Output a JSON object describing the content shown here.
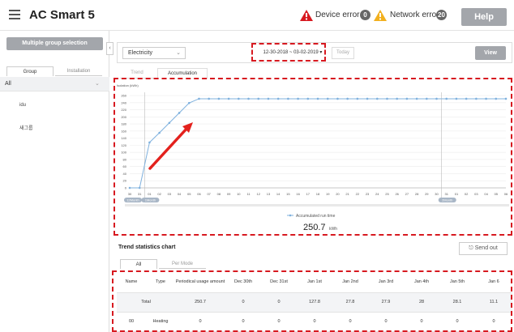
{
  "app": {
    "title": "AC Smart 5"
  },
  "header": {
    "device_error_label": "Device error",
    "device_error_count": "0",
    "network_error_label": "Network error",
    "network_error_count": "20",
    "help_label": "Help"
  },
  "sidebar": {
    "multi_select_label": "Multiple group selection",
    "tabs": [
      {
        "label": "Group"
      },
      {
        "label": "Installation"
      }
    ],
    "all_label": "All",
    "items": [
      {
        "label": "idu"
      },
      {
        "label": "새그룹"
      }
    ]
  },
  "filters": {
    "energy_type": "Electricity",
    "date_range": "12-30-2018 ~ 03-02-2019 ▾",
    "today_label": "Today",
    "view_label": "View"
  },
  "chart_tabs": [
    {
      "label": "Trend"
    },
    {
      "label": "Accumulation"
    }
  ],
  "colors": {
    "series": "#7fb1de",
    "highlight": "#d71920",
    "arrow": "#e3211d"
  },
  "chart_data": {
    "type": "line",
    "ylabel": "Isolation (kWh)",
    "ylim": [
      0,
      260
    ],
    "yticks": [
      0,
      20,
      40,
      60,
      80,
      100,
      120,
      140,
      160,
      180,
      200,
      220,
      240,
      260
    ],
    "x": [
      "30",
      "31",
      "01",
      "02",
      "03",
      "04",
      "05",
      "06",
      "07",
      "08",
      "09",
      "10",
      "11",
      "12",
      "13",
      "14",
      "15",
      "16",
      "17",
      "18",
      "19",
      "20",
      "21",
      "22",
      "23",
      "24",
      "25",
      "26",
      "27",
      "28",
      "29",
      "30",
      "31",
      "01",
      "02",
      "03",
      "04",
      "05",
      "06"
    ],
    "month_labels": [
      {
        "label": "12Month",
        "at": "30"
      },
      {
        "label": "1Month",
        "at": "01"
      },
      {
        "label": "2Month",
        "at": "31"
      }
    ],
    "series": [
      {
        "name": "Accumulated run time",
        "values": [
          0,
          0,
          128,
          155,
          183,
          211,
          239,
          251,
          251,
          251,
          251,
          251,
          251,
          251,
          251,
          251,
          251,
          251,
          251,
          251,
          251,
          251,
          251,
          251,
          251,
          251,
          251,
          251,
          251,
          251,
          251,
          251,
          251,
          251,
          251,
          251,
          251,
          251,
          251
        ]
      }
    ],
    "total_value": "250.7",
    "total_unit": "kWh"
  },
  "stats": {
    "title": "Trend statistics chart",
    "send_label": "Send out",
    "tabs": [
      {
        "label": "All"
      },
      {
        "label": "Per Mode"
      }
    ],
    "headers": [
      "Name",
      "Type",
      "Periodical usage amount",
      "Dec 30th",
      "Dec 31st",
      "Jan 1st",
      "Jan 2nd",
      "Jan 3rd",
      "Jan 4th",
      "Jan 5th",
      "Jan 6"
    ],
    "total_row": {
      "label": "Total",
      "values": [
        "250.7",
        "0",
        "0",
        "127.8",
        "27.8",
        "27.9",
        "28",
        "28.1",
        "11.1"
      ]
    },
    "row00": {
      "name": "00",
      "type": "Heating",
      "values": [
        "0",
        "0",
        "0",
        "0",
        "0",
        "0",
        "0",
        "0",
        "0"
      ]
    }
  }
}
